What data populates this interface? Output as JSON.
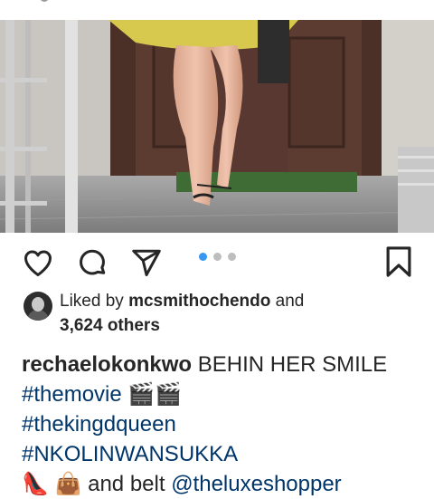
{
  "post": {
    "liked_by_prefix": "Liked by",
    "liked_by_user": "mcsmithochendo",
    "liked_by_and": "and",
    "liked_by_others": "3,624 others",
    "author": "rechaelokonkwo",
    "caption_text": "BEHIN HER SMILE",
    "hashtag_1": "#themovie",
    "emoji_1": "🎬🎬",
    "hashtag_2": "#thekingdqueen",
    "hashtag_3": "#NKOLINWANSUKKA",
    "line5_emoji": "👠 👜",
    "line5_text": "and belt",
    "mention": "@theluxeshopper"
  },
  "icons": {
    "like": "heart-icon",
    "comment": "comment-icon",
    "share": "send-icon",
    "save": "bookmark-icon"
  },
  "carousel": {
    "total": 3,
    "active": 1
  },
  "colors": {
    "accent": "#3897f0",
    "hashtag": "#003569",
    "text": "#262626"
  }
}
